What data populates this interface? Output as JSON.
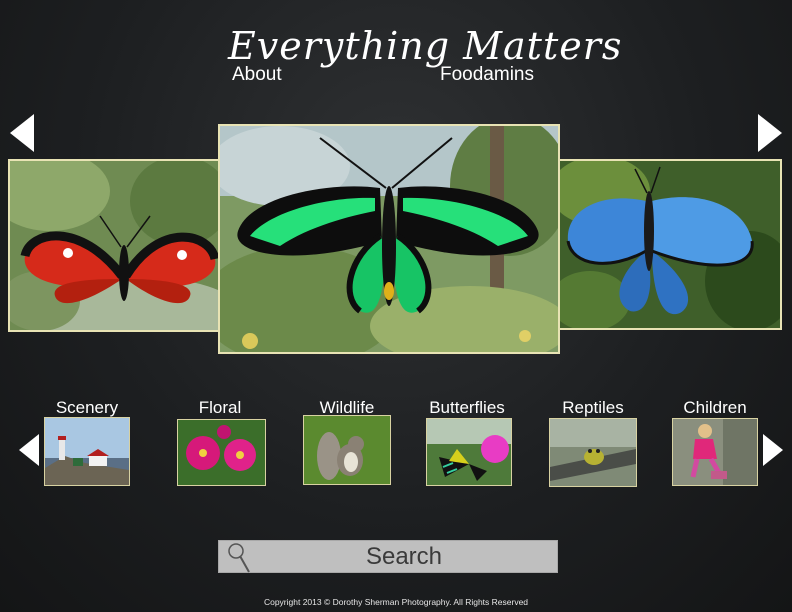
{
  "header": {
    "logo_text": "Everything Matters",
    "nav": [
      {
        "label": "About"
      },
      {
        "label": "Foodamins"
      }
    ]
  },
  "carousel": {
    "slides": [
      {
        "name": "red-butterfly"
      },
      {
        "name": "green-birdwing-butterfly"
      },
      {
        "name": "blue-morpho-butterfly"
      }
    ]
  },
  "categories": [
    {
      "label": "Scenery"
    },
    {
      "label": "Floral"
    },
    {
      "label": "Wildlife"
    },
    {
      "label": "Butterflies"
    },
    {
      "label": "Reptiles"
    },
    {
      "label": "Children"
    }
  ],
  "search": {
    "placeholder": "Search"
  },
  "footer": {
    "copyright": "Copyright 2013 © Dorothy Sherman Photography. All Rights Reserved"
  },
  "colors": {
    "frame": "#e8e3b4",
    "search_bg": "#bfbfbf"
  }
}
